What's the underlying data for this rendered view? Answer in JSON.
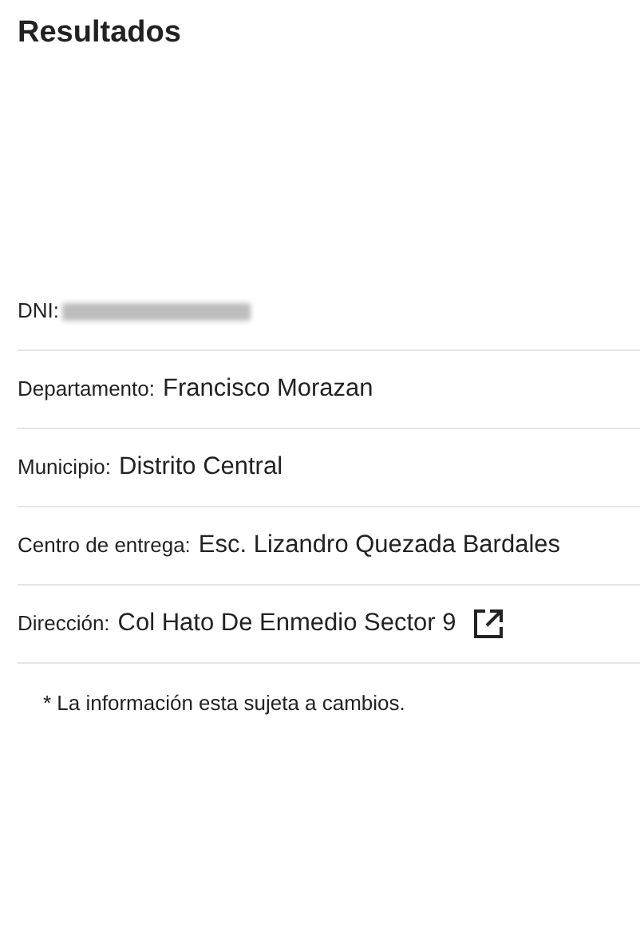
{
  "title": "Resultados",
  "fields": [
    {
      "kind": "redacted",
      "label": "DNI:"
    },
    {
      "kind": "text",
      "label": "Departamento:",
      "value": "Francisco Morazan"
    },
    {
      "kind": "text",
      "label": "Municipio:",
      "value": "Distrito Central"
    },
    {
      "kind": "text",
      "label": "Centro de entrega:",
      "value": "Esc. Lizandro Quezada Bardales"
    },
    {
      "kind": "link",
      "label": "Dirección:",
      "value": "Col Hato De Enmedio Sector 9"
    }
  ],
  "note": "* La información esta sujeta a cambios."
}
